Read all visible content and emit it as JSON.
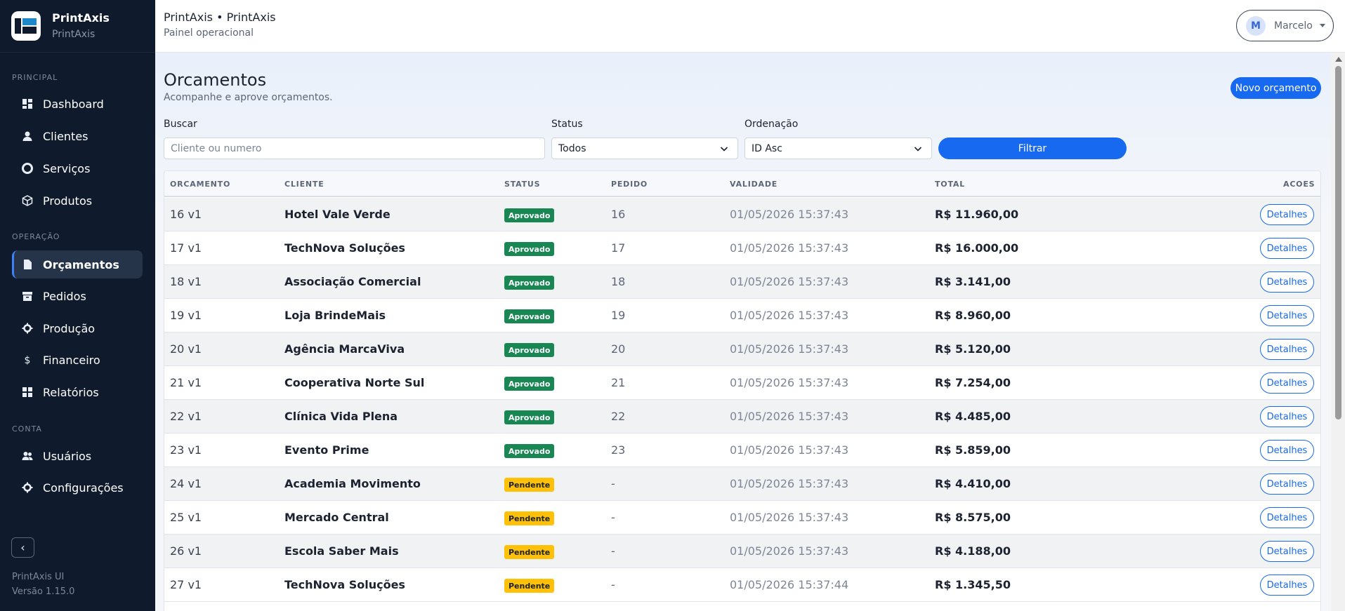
{
  "app": {
    "name": "PrintAxis",
    "sub": "PrintAxis",
    "logo_icon": "printaxis-logo"
  },
  "sidebar": {
    "sections": [
      "PRINCIPAL",
      "OPERAÇÃO",
      "CONTA"
    ],
    "items": [
      {
        "label": "Dashboard",
        "icon": "dashboard-icon"
      },
      {
        "label": "Clientes",
        "icon": "user-icon"
      },
      {
        "label": "Serviços",
        "icon": "gear-icon"
      },
      {
        "label": "Produtos",
        "icon": "box-icon"
      },
      {
        "label": "Orçamentos",
        "icon": "document-icon",
        "active": true
      },
      {
        "label": "Pedidos",
        "icon": "archive-icon"
      },
      {
        "label": "Produção",
        "icon": "cog-icon"
      },
      {
        "label": "Financeiro",
        "icon": "dollar-icon"
      },
      {
        "label": "Relatórios",
        "icon": "report-icon"
      },
      {
        "label": "Usuários",
        "icon": "users-icon"
      },
      {
        "label": "Configurações",
        "icon": "settings-icon"
      }
    ],
    "collapse_icon": "chevron-left-icon",
    "footer_line1": "PrintAxis UI",
    "footer_line2": "Versão 1.15.0"
  },
  "topbar": {
    "title": "PrintAxis • PrintAxis",
    "subtitle": "Painel operacional",
    "user_initial": "M",
    "user_name": "Marcelo"
  },
  "page": {
    "title": "Orcamentos",
    "subtitle": "Acompanhe e aprove orçamentos.",
    "new_button": "Novo orçamento"
  },
  "filters": {
    "search_label": "Buscar",
    "search_placeholder": "Cliente ou numero",
    "status_label": "Status",
    "status_value": "Todos",
    "order_label": "Ordenação",
    "order_value": "ID Asc",
    "filter_button": "Filtrar"
  },
  "table": {
    "headers": [
      "ORCAMENTO",
      "CLIENTE",
      "STATUS",
      "PEDIDO",
      "VALIDADE",
      "TOTAL",
      "ACOES"
    ],
    "action_label": "Detalhes",
    "rows": [
      {
        "orcamento": "16 v1",
        "cliente": "Hotel Vale Verde",
        "status": "Aprovado",
        "pedido": "16",
        "validade": "01/05/2026 15:37:43",
        "total": "R$ 11.960,00"
      },
      {
        "orcamento": "17 v1",
        "cliente": "TechNova Soluções",
        "status": "Aprovado",
        "pedido": "17",
        "validade": "01/05/2026 15:37:43",
        "total": "R$ 16.000,00"
      },
      {
        "orcamento": "18 v1",
        "cliente": "Associação Comercial",
        "status": "Aprovado",
        "pedido": "18",
        "validade": "01/05/2026 15:37:43",
        "total": "R$ 3.141,00"
      },
      {
        "orcamento": "19 v1",
        "cliente": "Loja BrindeMais",
        "status": "Aprovado",
        "pedido": "19",
        "validade": "01/05/2026 15:37:43",
        "total": "R$ 8.960,00"
      },
      {
        "orcamento": "20 v1",
        "cliente": "Agência MarcaViva",
        "status": "Aprovado",
        "pedido": "20",
        "validade": "01/05/2026 15:37:43",
        "total": "R$ 5.120,00"
      },
      {
        "orcamento": "21 v1",
        "cliente": "Cooperativa Norte Sul",
        "status": "Aprovado",
        "pedido": "21",
        "validade": "01/05/2026 15:37:43",
        "total": "R$ 7.254,00"
      },
      {
        "orcamento": "22 v1",
        "cliente": "Clínica Vida Plena",
        "status": "Aprovado",
        "pedido": "22",
        "validade": "01/05/2026 15:37:43",
        "total": "R$ 4.485,00"
      },
      {
        "orcamento": "23 v1",
        "cliente": "Evento Prime",
        "status": "Aprovado",
        "pedido": "23",
        "validade": "01/05/2026 15:37:43",
        "total": "R$ 5.859,00"
      },
      {
        "orcamento": "24 v1",
        "cliente": "Academia Movimento",
        "status": "Pendente",
        "pedido": "-",
        "validade": "01/05/2026 15:37:43",
        "total": "R$ 4.410,00"
      },
      {
        "orcamento": "25 v1",
        "cliente": "Mercado Central",
        "status": "Pendente",
        "pedido": "-",
        "validade": "01/05/2026 15:37:43",
        "total": "R$ 8.575,00"
      },
      {
        "orcamento": "26 v1",
        "cliente": "Escola Saber Mais",
        "status": "Pendente",
        "pedido": "-",
        "validade": "01/05/2026 15:37:43",
        "total": "R$ 4.188,00"
      },
      {
        "orcamento": "27 v1",
        "cliente": "TechNova Soluções",
        "status": "Pendente",
        "pedido": "-",
        "validade": "01/05/2026 15:37:44",
        "total": "R$ 1.345,50"
      }
    ]
  },
  "colors": {
    "sidebar_bg": "#0f1b2d",
    "accent": "#1769f0",
    "approved": "#198754",
    "pending": "#ffc107"
  }
}
